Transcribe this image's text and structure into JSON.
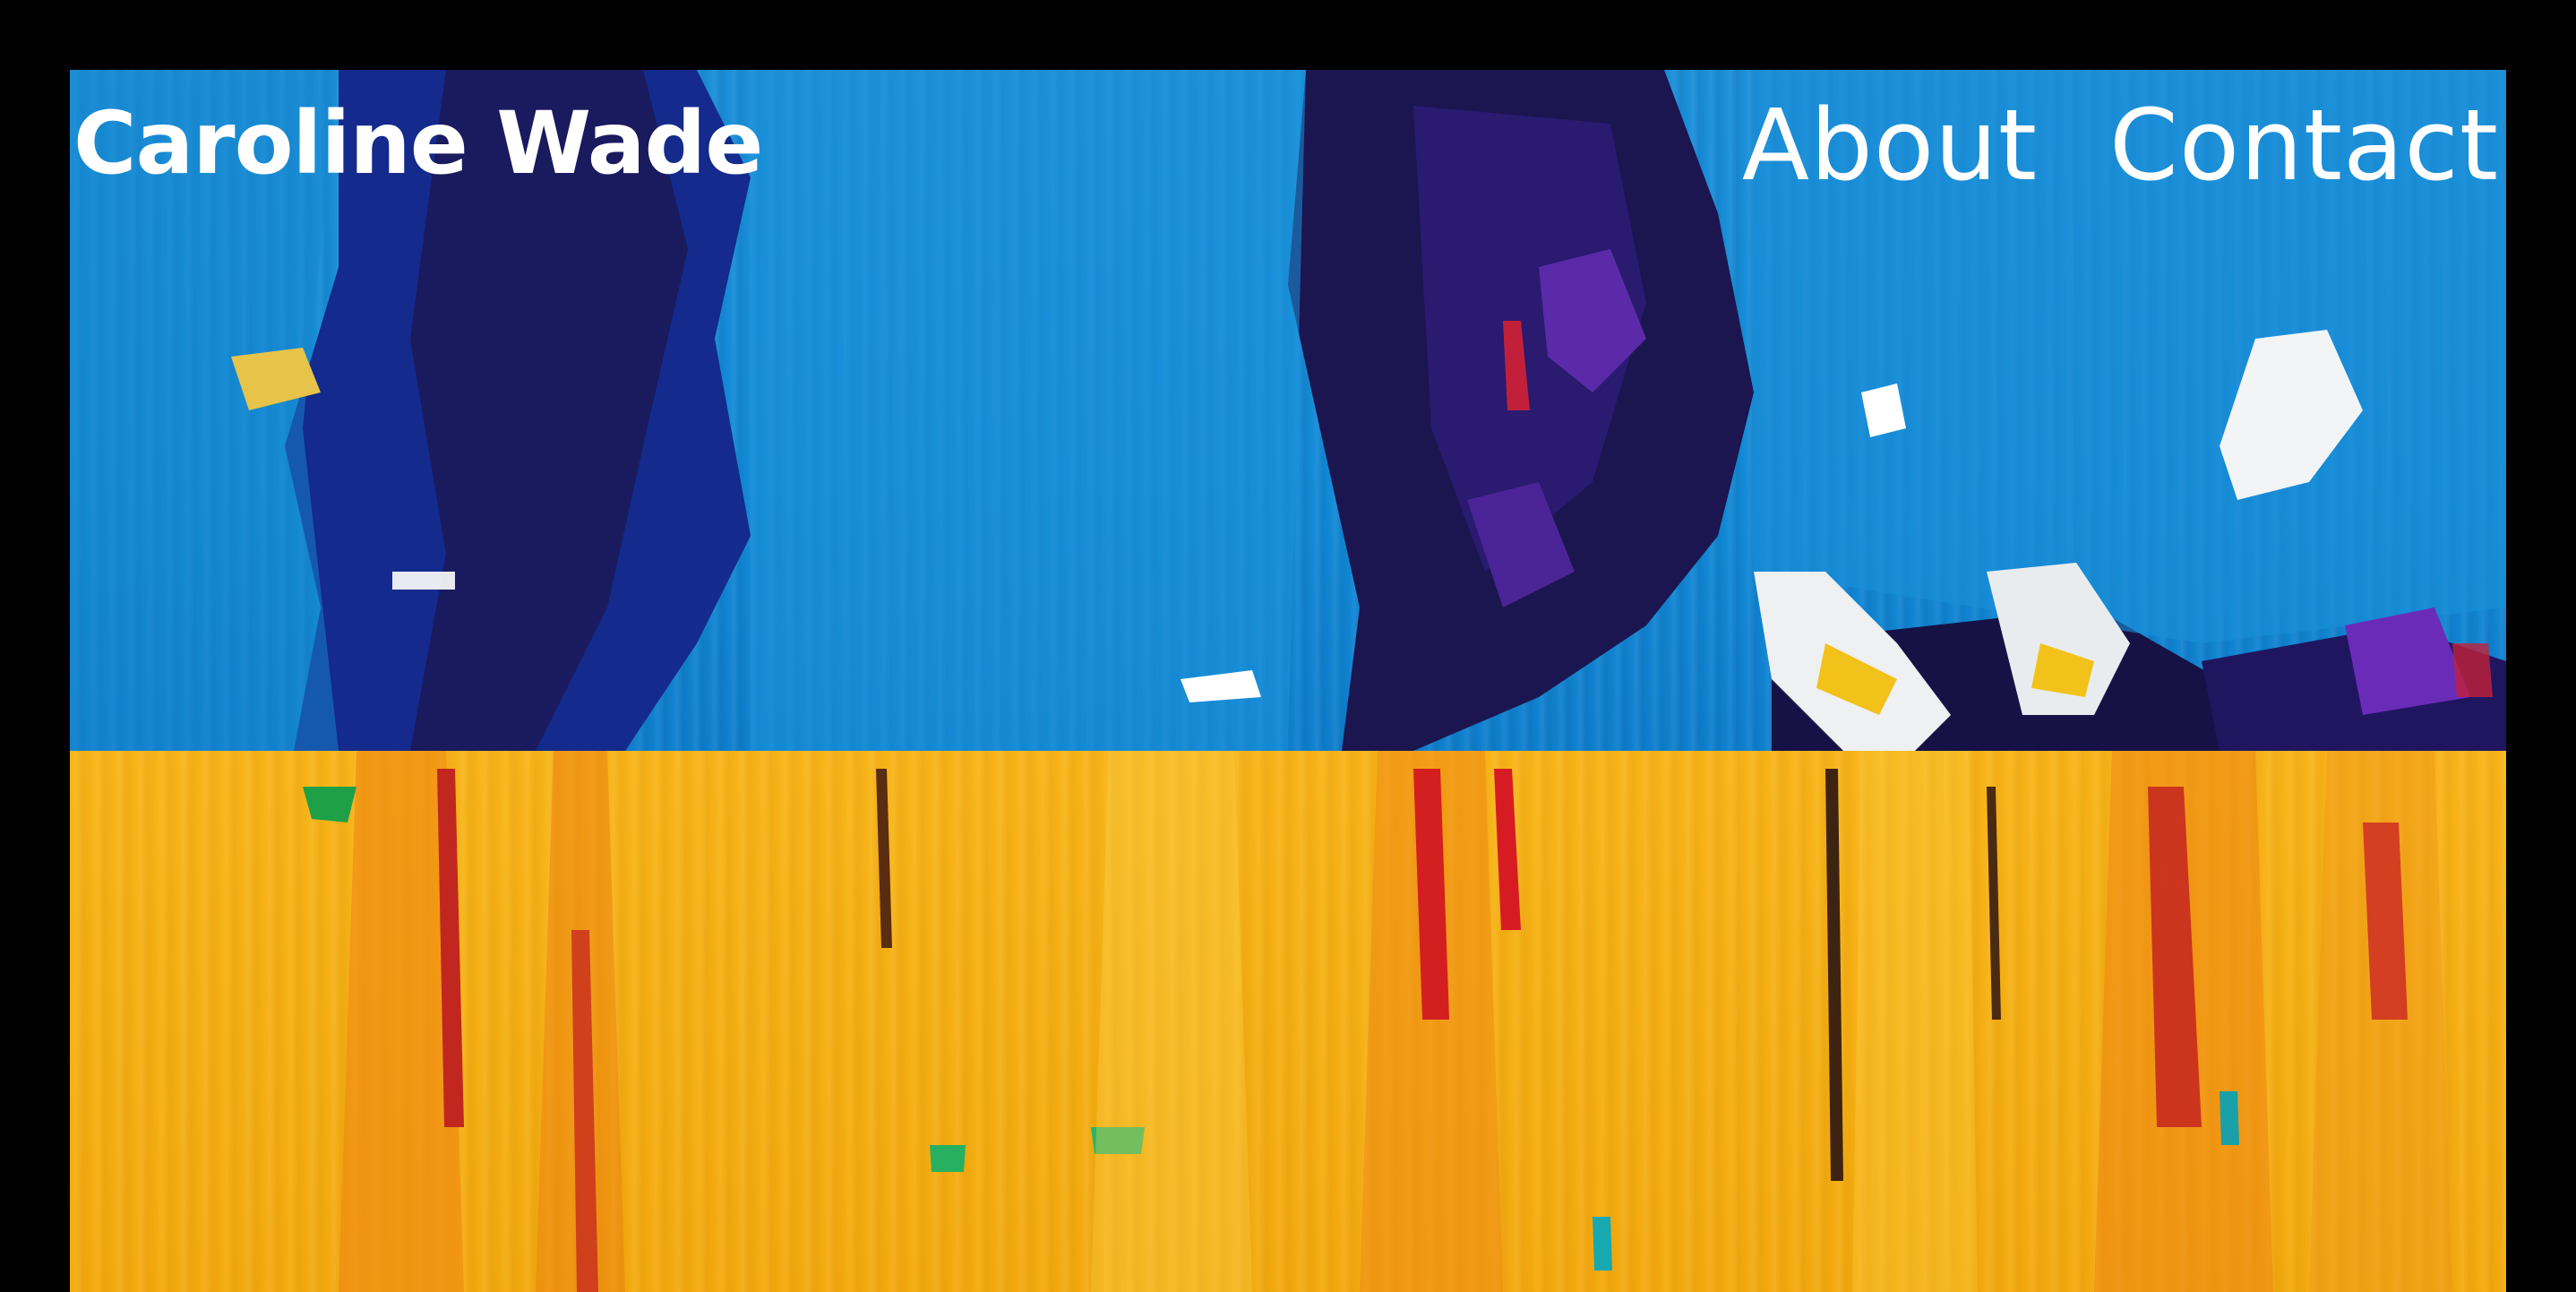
{
  "site": {
    "brand_name": "Caroline Wade"
  },
  "nav": {
    "items": [
      {
        "label": "About"
      },
      {
        "label": "Contact"
      }
    ]
  },
  "colors": {
    "background": "#000000",
    "blue_paint": "#128ad6",
    "navy_paint": "#1a1450",
    "yellow_paint": "#f5b015",
    "text": "#ffffff"
  }
}
